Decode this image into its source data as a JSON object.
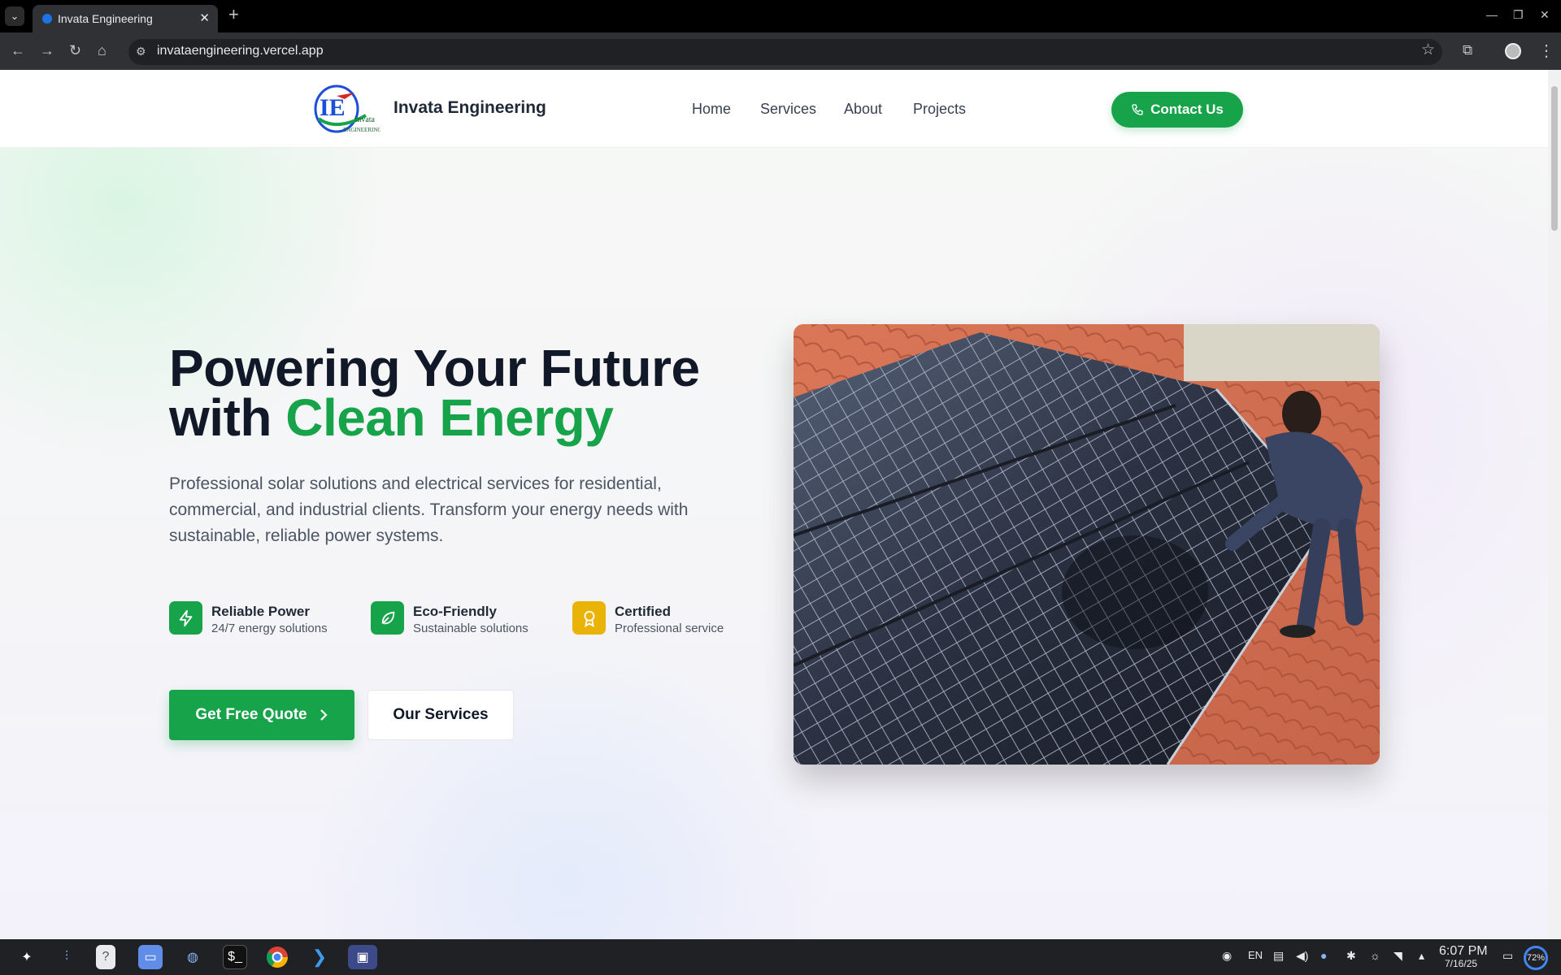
{
  "browser": {
    "tab_title": "Invata Engineering",
    "tab_close": "✕",
    "new_tab": "+",
    "window_controls": [
      "—",
      "❐",
      "✕"
    ],
    "url": "invataengineering.vercel.app"
  },
  "site": {
    "brand": "Invata Engineering",
    "logo_text": [
      "Invata",
      "ENGINEERING"
    ],
    "nav": [
      "Home",
      "Services",
      "About",
      "Projects"
    ],
    "contact_label": "Contact Us",
    "colors": {
      "accent": "#16a34a",
      "heading": "#111827",
      "gold": "#eab308"
    }
  },
  "hero": {
    "title_line1": "Powering Your Future",
    "title_line2_prefix": "with ",
    "title_line2_accent": "Clean Energy",
    "description": "Professional solar solutions and electrical services for residential, commercial, and industrial clients. Transform your energy needs with sustainable, reliable power systems.",
    "features": [
      {
        "icon": "lightning-icon",
        "title": "Reliable Power",
        "subtitle": "24/7 energy solutions",
        "color": "#16a34a"
      },
      {
        "icon": "leaf-icon",
        "title": "Eco-Friendly",
        "subtitle": "Sustainable solutions",
        "color": "#16a34a"
      },
      {
        "icon": "award-icon",
        "title": "Certified",
        "subtitle": "Professional service",
        "color": "#eab308"
      }
    ],
    "primary_cta": "Get Free Quote",
    "secondary_cta": "Our Services"
  },
  "taskbar": {
    "time": "6:07 PM",
    "date": "7/16/25",
    "language": "EN",
    "battery": "72%"
  }
}
